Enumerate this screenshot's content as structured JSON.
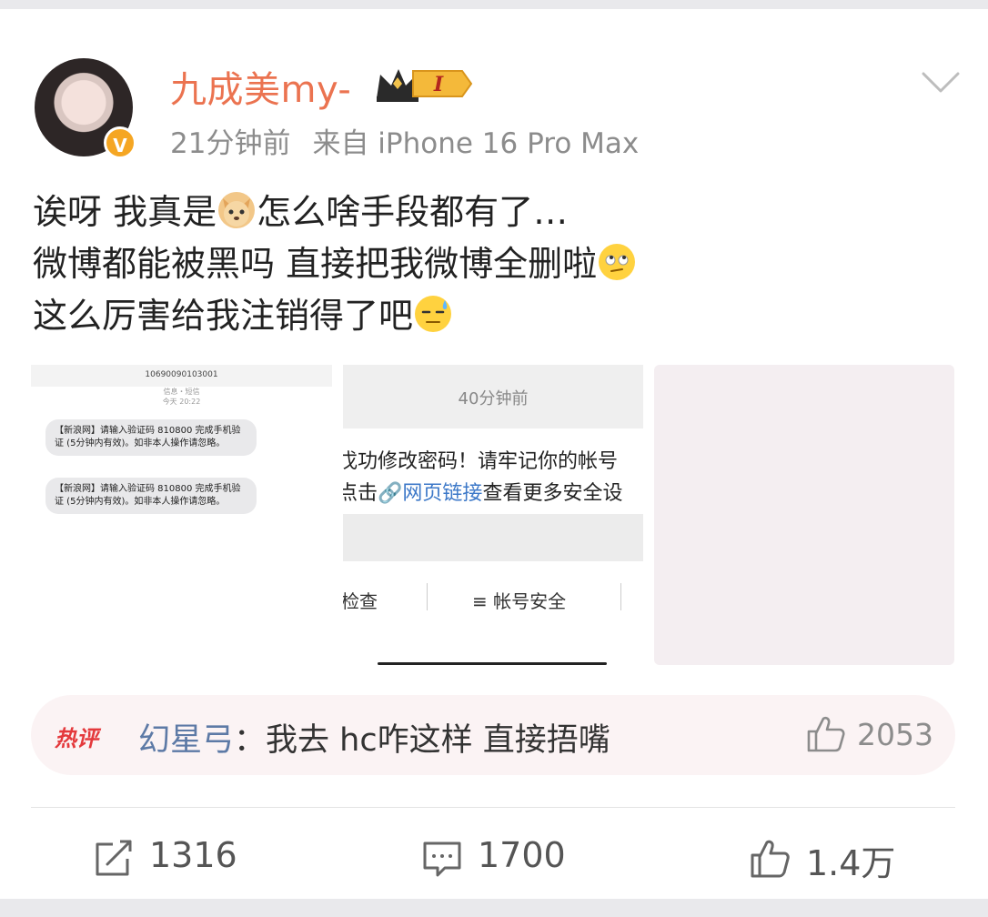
{
  "post": {
    "username": "九成美my-",
    "member_level": "I",
    "time": "21分钟前",
    "source": "来自 iPhone 16 Pro Max",
    "text_lines": [
      "诶呀 我真是",
      "怎么啥手段都有了…",
      "微博都能被黑吗 直接把我微博全删啦",
      "这么厉害给我注销得了吧"
    ],
    "emojis": [
      "dog-face-emoji",
      "eye-roll-emoji",
      "sweat-emoji"
    ]
  },
  "images": {
    "sms": {
      "number": "10690090103001",
      "sub1": "信息・短信",
      "sub2": "今天 20:22",
      "messages": [
        "【新浪网】请输入验证码 810800 完成手机验证 (5分钟内有效)。如非本人操作请忽略。",
        "【新浪网】请输入验证码 810800 完成手机验证 (5分钟内有效)。如非本人操作请忽略。"
      ]
    },
    "notice": {
      "time": "40分钟前",
      "line1": "戊功修改密码！请牢记你的帐号",
      "line2_prefix": "点击",
      "line2_link": "网页链接",
      "line2_suffix": "查看更多安全设",
      "button1": "检查",
      "button2": "≡ 帐号安全"
    }
  },
  "hot_comment": {
    "tag": "热评",
    "nickname": "幻星弓",
    "separator": "：",
    "text": "我去 hc咋这样 直接捂嘴",
    "likes": "2053"
  },
  "actions": {
    "repost": "1316",
    "comment": "1700",
    "like": "1.4万"
  },
  "colors": {
    "username": "#eb7350",
    "verified_badge": "#f5a623",
    "link": "#3c78c8",
    "hot_tag": "#e4393c",
    "nickname": "#5d7aa6"
  }
}
